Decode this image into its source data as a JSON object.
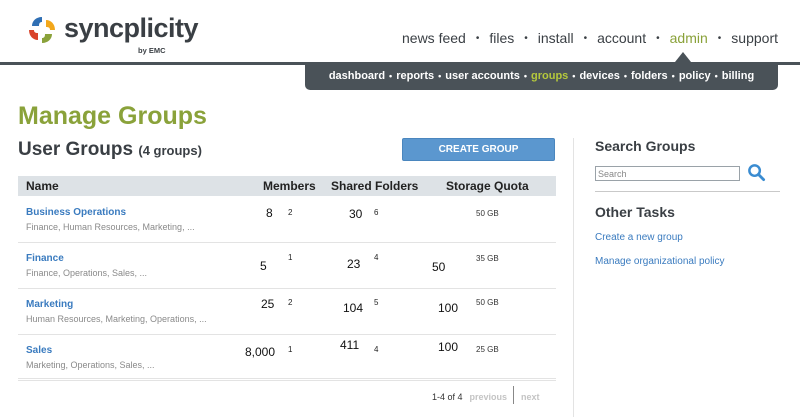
{
  "brand": {
    "name": "syncplicity",
    "byline": "by EMC"
  },
  "topnav": [
    {
      "label": "news feed"
    },
    {
      "label": "files"
    },
    {
      "label": "install"
    },
    {
      "label": "account"
    },
    {
      "label": "admin",
      "active": true
    },
    {
      "label": "support"
    }
  ],
  "subnav": [
    {
      "label": "dashboard"
    },
    {
      "label": "reports"
    },
    {
      "label": "user accounts"
    },
    {
      "label": "groups",
      "active": true
    },
    {
      "label": "devices"
    },
    {
      "label": "folders"
    },
    {
      "label": "policy"
    },
    {
      "label": "billing"
    }
  ],
  "nav_separator": "•",
  "page": {
    "title": "Manage Groups",
    "section_title": "User Groups",
    "group_count": "(4 groups)",
    "create_button": "CREATE GROUP"
  },
  "table": {
    "columns": [
      "Name",
      "Members",
      "Shared Folders",
      "Storage Quota"
    ],
    "rows": [
      {
        "name": "Business Operations",
        "tags": "Finance, Human Resources, Marketing, ...",
        "members": "8",
        "members_sub": "2",
        "folders": "30",
        "folders_sub": "6",
        "storage": "",
        "quota": "50 GB"
      },
      {
        "name": "Finance",
        "tags": "Finance, Operations, Sales, ...",
        "members": "5",
        "members_sub": "1",
        "folders": "23",
        "folders_sub": "4",
        "storage": "50",
        "quota": "35 GB"
      },
      {
        "name": "Marketing",
        "tags": "Human Resources, Marketing, Operations, ...",
        "members": "25",
        "members_sub": "2",
        "folders": "104",
        "folders_sub": "5",
        "storage": "100",
        "quota": "50 GB"
      },
      {
        "name": "Sales",
        "tags": "Marketing, Operations, Sales, ...",
        "members": "8,000",
        "members_sub": "1",
        "folders": "411",
        "folders_sub": "4",
        "storage": "100",
        "quota": "25 GB"
      }
    ]
  },
  "pagination": {
    "range": "1-4 of 4",
    "previous": "previous",
    "next": "next"
  },
  "sidebar": {
    "search_title": "Search Groups",
    "search_placeholder": "Search",
    "other_tasks_title": "Other Tasks",
    "links": [
      "Create a new group",
      "Manage organizational policy"
    ]
  },
  "colors": {
    "accent_green": "#8aa23a",
    "nav_dark": "#4a5258",
    "link_blue": "#3a7bbf",
    "button_blue": "#5b97cf"
  },
  "icons": {
    "search": "search-icon",
    "logo": "syncplicity-logo-icon"
  }
}
